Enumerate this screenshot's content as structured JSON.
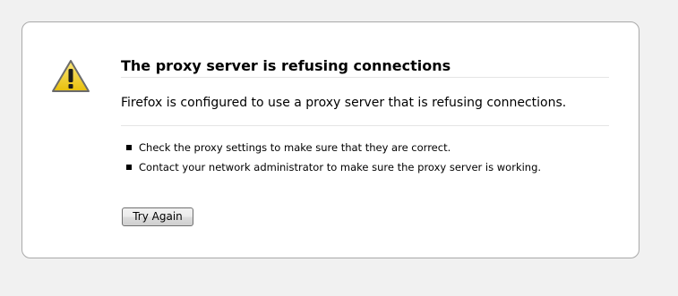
{
  "error": {
    "title": "The proxy server is refusing connections",
    "short_description": "Firefox is configured to use a proxy server that is refusing connections.",
    "suggestions": [
      "Check the proxy settings to make sure that they are correct.",
      "Contact your network administrator to make sure the proxy server is working."
    ],
    "try_again_label": "Try Again",
    "icon": "warning-icon"
  },
  "colors": {
    "page_background": "#f1f1f1",
    "card_background": "#ffffff",
    "card_border": "#a9a9a9",
    "icon_fill": "#f5d21d",
    "icon_outline": "#6b6b6b"
  }
}
